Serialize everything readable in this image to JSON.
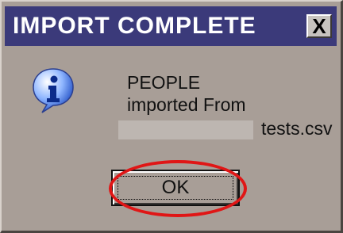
{
  "window": {
    "title": "IMPORT COMPLETE",
    "close_label": "X"
  },
  "message": {
    "line1": "PEOPLE",
    "line2": "imported From",
    "line3_suffix": "tests.csv"
  },
  "buttons": {
    "ok_label": "OK"
  },
  "icons": {
    "info": "info-icon",
    "close": "close-icon"
  },
  "colors": {
    "titlebar": "#3b3a7a",
    "dialog_bg": "#a89e97",
    "highlight": "#e01616"
  }
}
